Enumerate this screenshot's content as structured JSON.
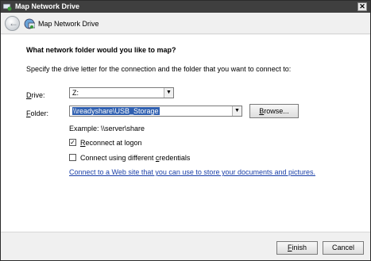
{
  "window": {
    "title": "Map Network Drive",
    "close_glyph": "✕"
  },
  "header": {
    "title": "Map Network Drive"
  },
  "content": {
    "question": "What network folder would you like to map?",
    "instructions": "Specify the drive letter for the connection and the folder that you want to connect to:",
    "drive": {
      "label_prefix": "",
      "label_key": "D",
      "label_rest": "rive:",
      "value": "Z:"
    },
    "folder": {
      "label_key": "F",
      "label_rest": "older:",
      "value": "\\\\readyshare\\USB_Storage"
    },
    "browse_button": {
      "key": "B",
      "rest": "rowse..."
    },
    "example": "Example: \\\\server\\share",
    "reconnect": {
      "key": "R",
      "rest": "econnect at logon",
      "checked": true
    },
    "different_credentials": {
      "pre": "Connect using different ",
      "key": "c",
      "rest": "redentials",
      "checked": false
    },
    "link": "Connect to a Web site that you can use to store your documents and pictures."
  },
  "footer": {
    "finish": {
      "key": "F",
      "rest": "inish"
    },
    "cancel": "Cancel"
  },
  "colors": {
    "titlebar": "#3f3f3f",
    "link": "#1a3fa8",
    "selection": "#3060b0"
  }
}
